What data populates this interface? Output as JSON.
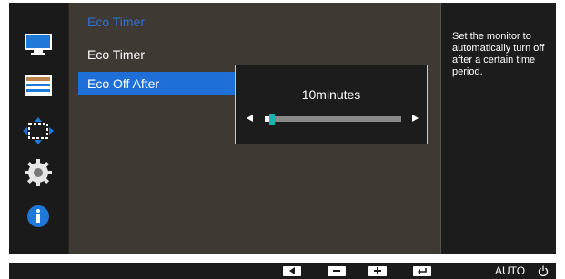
{
  "sidebar": {
    "icons": [
      {
        "name": "picture-icon"
      },
      {
        "name": "settings-bars-icon"
      },
      {
        "name": "position-arrows-icon"
      },
      {
        "name": "gear-icon"
      },
      {
        "name": "info-icon"
      }
    ]
  },
  "menu": {
    "title": "Eco Timer",
    "items": [
      {
        "label": "Eco Timer"
      },
      {
        "label": "Eco Off After"
      }
    ]
  },
  "popup": {
    "value_text": "10minutes",
    "level_fraction": 0.05
  },
  "help": {
    "text": "Set the monitor to automatically turn off after a certain time period."
  },
  "bottom_bar": {
    "auto_label": "AUTO"
  },
  "colors": {
    "accent": "#1f6fd9",
    "title_blue": "#2f6fd8",
    "slider_thumb": "#19b1b1"
  }
}
